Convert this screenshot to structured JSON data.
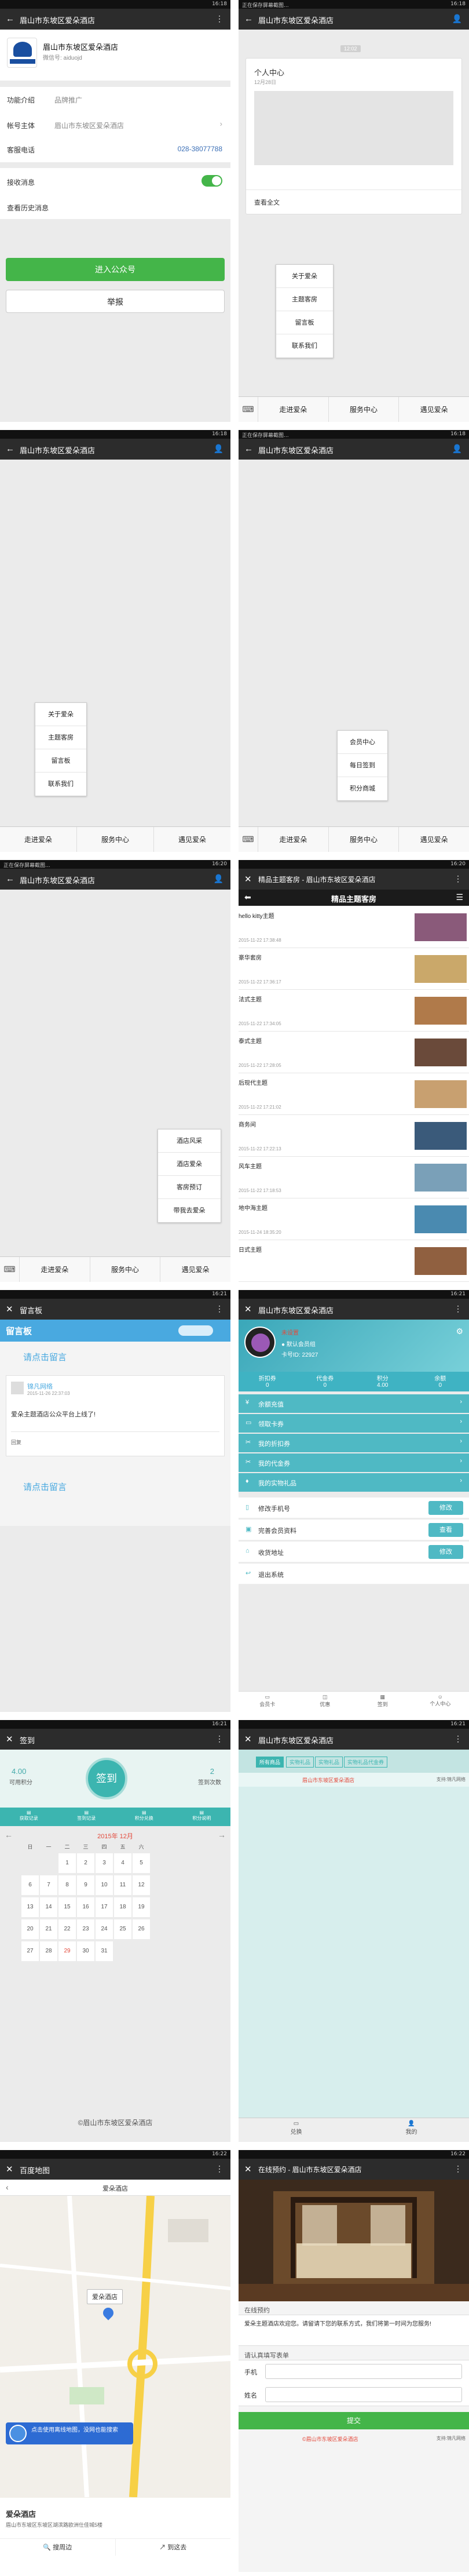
{
  "status": {
    "time_1": "16:18",
    "time_2": "16:18",
    "time_3": "16:18",
    "time_4": "16:20",
    "time_5": "16:21",
    "time_6": "16:21",
    "time_7": "16:21",
    "time_8": "16:22",
    "notice": "正在保存屏幕截图..."
  },
  "nav_title": "眉山市东坡区爱朵酒店",
  "account": {
    "name": "眉山市东坡区爱朵酒店",
    "wechat_id": "微信号: aiduojd",
    "func_label": "功能介绍",
    "func_value": "品牌推广",
    "subject_label": "帐号主体",
    "subject_value": "眉山市东坡区爱朵酒店",
    "phone_label": "客服电话",
    "phone_value": "028-38077788",
    "receive_label": "接收消息",
    "history_label": "查看历史消息",
    "enter_button": "进入公众号",
    "report_button": "举报"
  },
  "menu": {
    "m1": "走进爱朵",
    "m2": "服务中心",
    "m3": "遇见爱朵"
  },
  "popup_about": [
    "关于爱朵",
    "主题客房",
    "留言板",
    "联系我们"
  ],
  "popup_service": [
    "会员中心",
    "每日签到",
    "积分商城"
  ],
  "popup_meet": [
    "酒店风采",
    "酒店爱朵",
    "客房预订",
    "带我去爱朵"
  ],
  "chat": {
    "time_chip": "12:02",
    "card_title": "个人中心",
    "card_date": "12月28日",
    "card_link": "查看全文"
  },
  "rooms": {
    "title": "精品主题客房 - 眉山市东坡区爱朵酒店",
    "header": "精品主题客房",
    "items": [
      {
        "name": "hello kitty主题",
        "date": "2015-11-22 17:38:48"
      },
      {
        "name": "豪华套房",
        "date": "2015-11-22 17:36:17"
      },
      {
        "name": "法式主题",
        "date": "2015-11-22 17:34:05"
      },
      {
        "name": "泰式主题",
        "date": "2015-11-22 17:28:05"
      },
      {
        "name": "后现代主题",
        "date": "2015-11-22 17:21:02"
      },
      {
        "name": "商务间",
        "date": "2015-11-22 17:22:13"
      },
      {
        "name": "风车主题",
        "date": "2015-11-22 17:18:53"
      },
      {
        "name": "地中海主题",
        "date": "2015-11-24 18:35:20"
      },
      {
        "name": "日式主题",
        "date": ""
      }
    ]
  },
  "board": {
    "nav": "留言板",
    "banner": "留言板",
    "click1": "请点击留言",
    "user": "锦凡网络",
    "user_date": "2015-11-26 22:37:03",
    "message": "爱朵主题酒店公众平台上线了!",
    "reply_label": "回复",
    "click2": "请点击留言"
  },
  "member": {
    "username": "未设置",
    "level": "● 默认会员组",
    "card_no": "卡号ID: 22927",
    "stats": [
      {
        "label": "折扣券",
        "value": "0"
      },
      {
        "label": "代金券",
        "value": "0"
      },
      {
        "label": "积分",
        "value": "4.00"
      },
      {
        "label": "余额",
        "value": "0"
      }
    ],
    "menu_items": [
      "余额充值",
      "领取卡券",
      "我的折扣券",
      "我的代金券",
      "我的实物礼品"
    ],
    "actions": [
      {
        "label": "修改手机号",
        "button": "修改"
      },
      {
        "label": "完善会员资料",
        "button": "查看"
      },
      {
        "label": "收货地址",
        "button": "修改"
      },
      {
        "label": "退出系统",
        "button": ""
      }
    ],
    "tabs": [
      "会员卡",
      "优惠",
      "签到",
      "个人中心"
    ]
  },
  "signin": {
    "nav": "签到",
    "points_value": "4.00",
    "points_label": "可用积分",
    "button": "签到",
    "days_value": "2",
    "days_label": "签到次数",
    "quick": [
      "获取记录",
      "签到记录",
      "积分兑换",
      "积分说明"
    ],
    "month": "2015年 12月",
    "weekdays": [
      "日",
      "一",
      "二",
      "三",
      "四",
      "五",
      "六"
    ],
    "weeks": [
      [
        "",
        "",
        "1",
        "2",
        "3",
        "4",
        "5"
      ],
      [
        "6",
        "7",
        "8",
        "9",
        "10",
        "11",
        "12"
      ],
      [
        "13",
        "14",
        "15",
        "16",
        "17",
        "18",
        "19"
      ],
      [
        "20",
        "21",
        "22",
        "23",
        "24",
        "25",
        "26"
      ],
      [
        "27",
        "28",
        "29",
        "30",
        "31",
        "",
        ""
      ]
    ],
    "footer": "©眉山市东坡区爱朵酒店"
  },
  "mall": {
    "tabs": [
      "所有商品",
      "实物礼品",
      "实物礼品",
      "实物礼品代金券"
    ],
    "shop": "眉山市东坡区爱朵酒店",
    "support": "支持:锦凡网络",
    "bottom": [
      "兑换",
      "我的"
    ]
  },
  "map": {
    "nav": "百度地图",
    "place": "爱朵酒店",
    "marker": "爱朵酒店",
    "tip": "点击使用离线地图，没网也能搜索",
    "addr_title": "爱朵酒店",
    "addr": "眉山市东坡区东坡区湖滨路欧洲仕佳城5楼",
    "near": "搜周边",
    "route": "到这去"
  },
  "booking": {
    "title": "在线预约 - 眉山市东坡区爱朵酒店",
    "section1": "在线预约",
    "notice": "爱朵主题酒店欢迎您。请留请下您的联系方式，我们将第一时间为您服务!",
    "section2": "请认真填写表单",
    "phone": "手机",
    "name": "姓名",
    "submit": "提交",
    "footer": "©眉山市东坡区爱朵酒店",
    "support": "支持:锦凡网络"
  },
  "colors": {
    "green": "#44b549",
    "teal": "#5bc0de",
    "sky": "#49a9e0",
    "red": "#e34a3c"
  }
}
